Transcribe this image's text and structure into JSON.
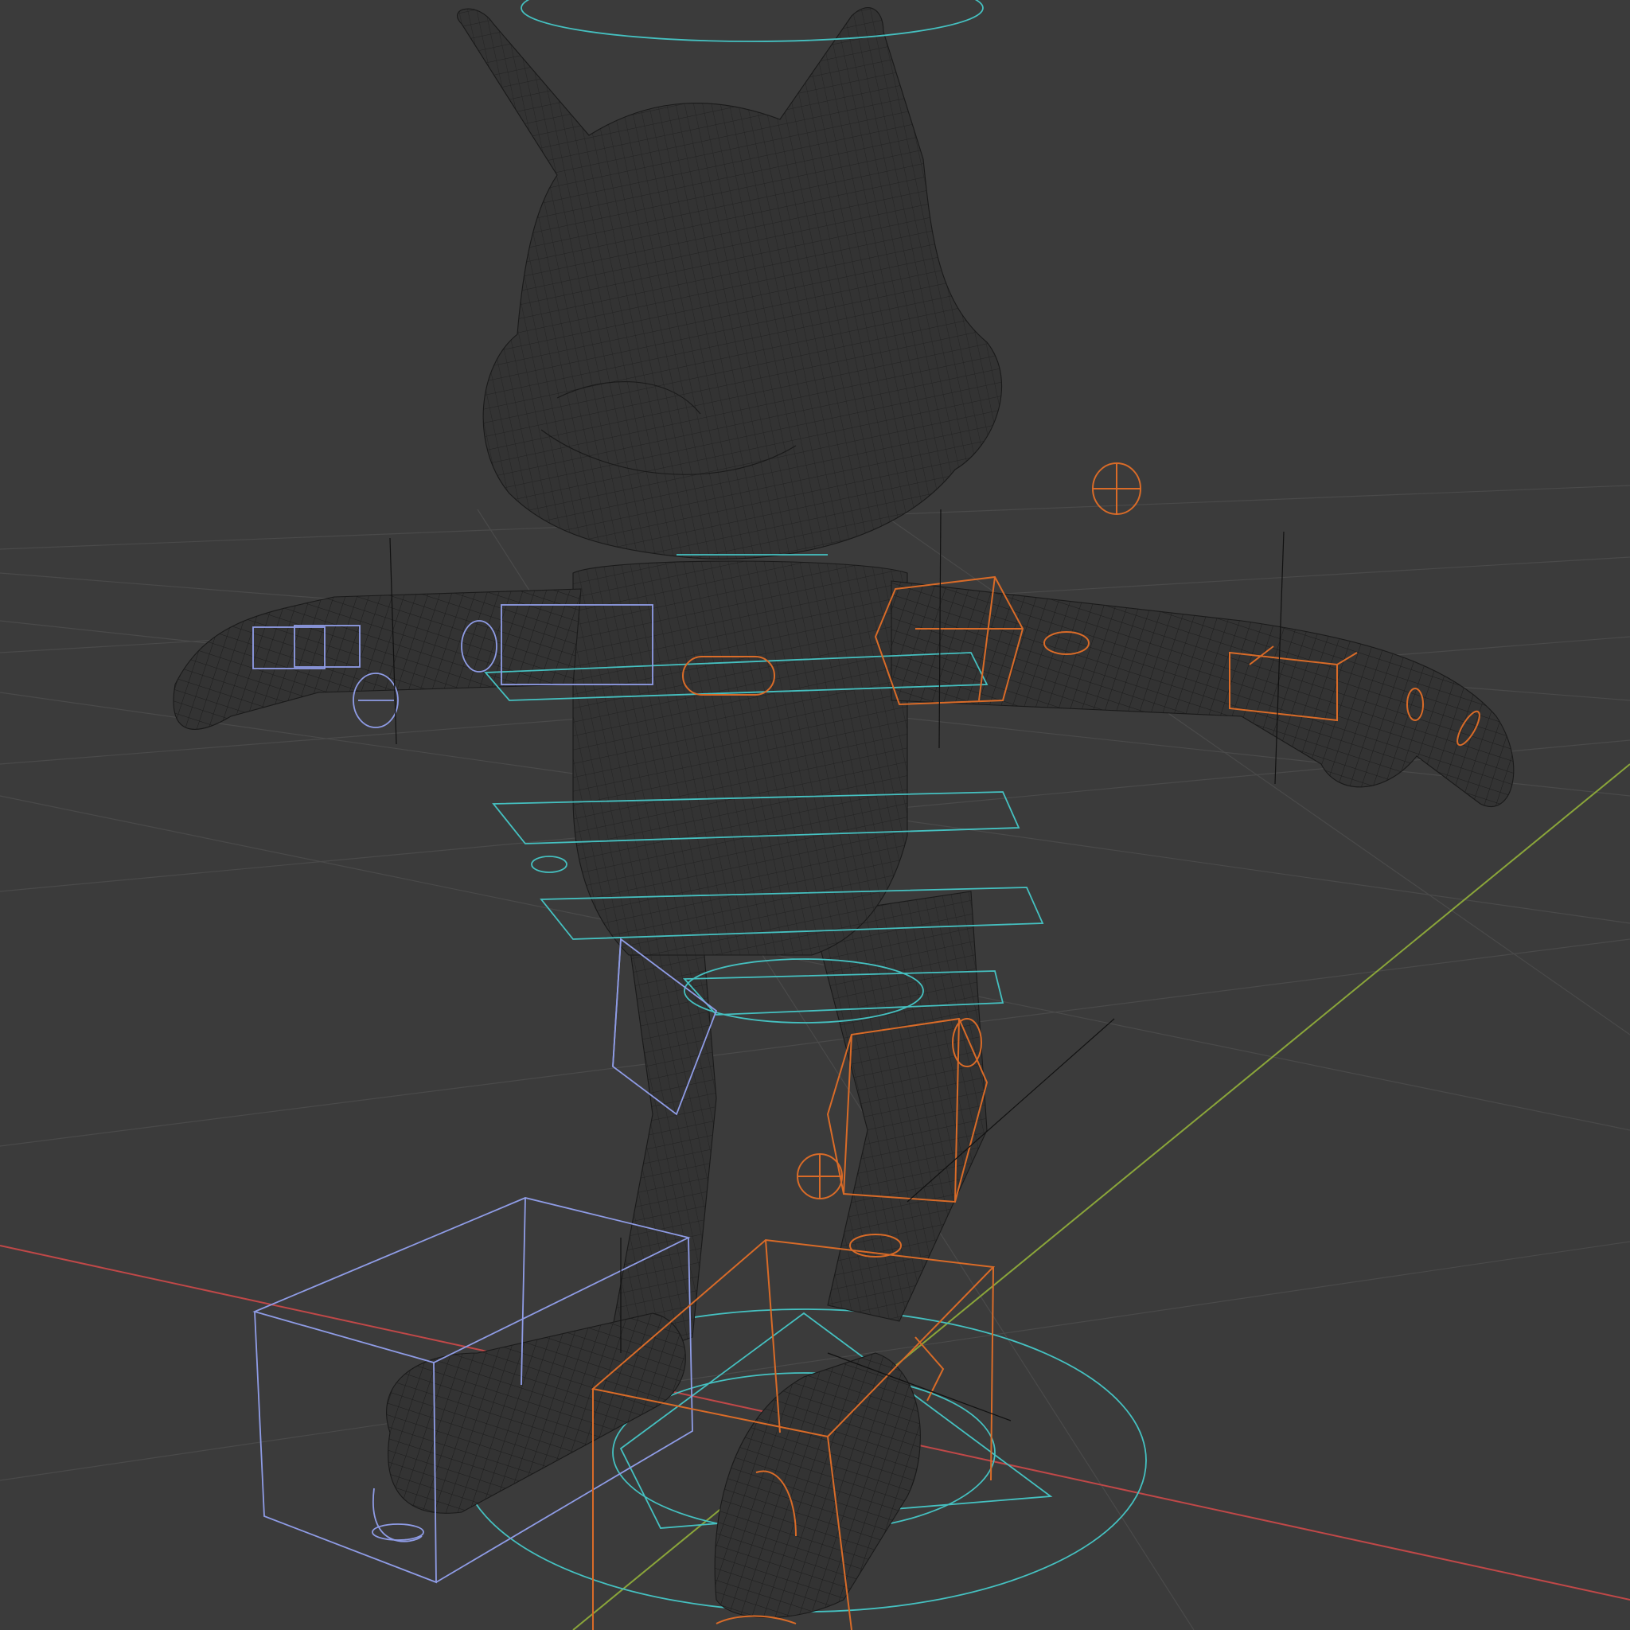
{
  "viewport": {
    "mode": "wireframe",
    "background": "#3b3b3b",
    "object": "character-rig",
    "colors": {
      "mesh": "#1a1a1a",
      "left_controls": "#8f9ce6",
      "right_controls": "#d96b28",
      "center_controls": "#45c1c1",
      "x_axis": "#c04848",
      "y_axis": "#8aa53a"
    }
  }
}
